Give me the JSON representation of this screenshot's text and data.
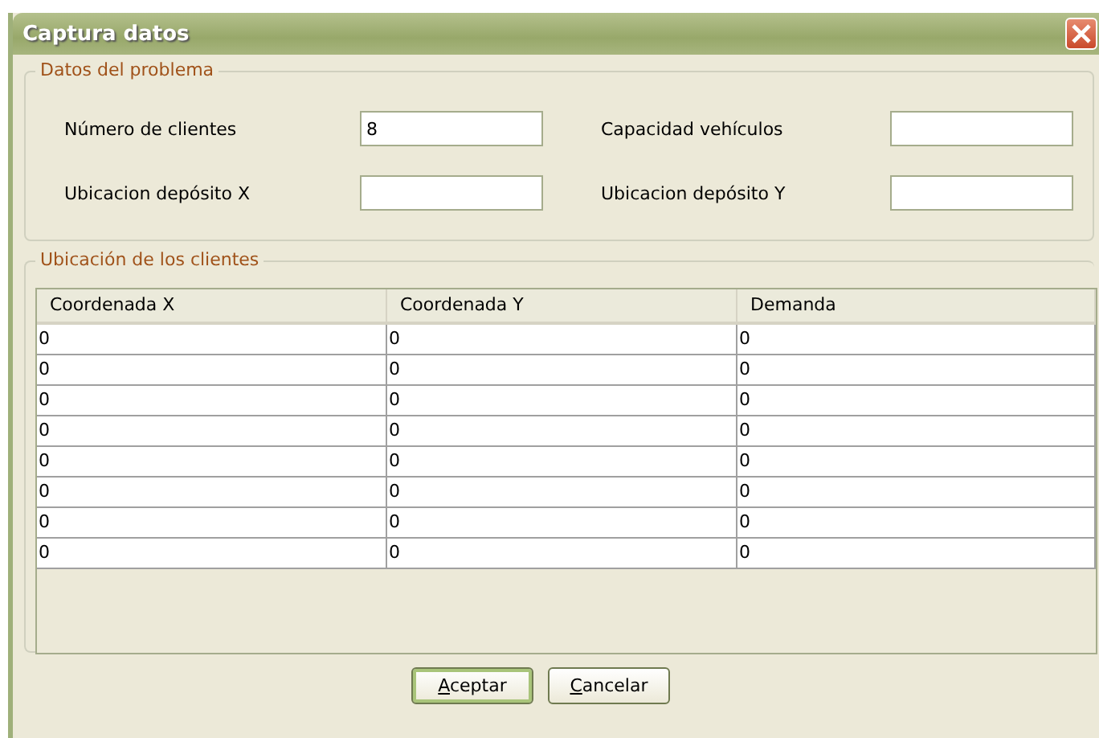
{
  "window": {
    "title": "Captura datos"
  },
  "problem_group": {
    "legend": "Datos del problema",
    "fields": [
      {
        "label": "Número de clientes",
        "value": "8"
      },
      {
        "label": "Capacidad vehículos"
      },
      {
        "label": "Ubicacion depósito X"
      },
      {
        "label": "Ubicacion depósito Y"
      }
    ]
  },
  "clients_group": {
    "legend": "Ubicación de los clientes",
    "table": {
      "columns": [
        "Coordenada X",
        "Coordenada Y",
        "Demanda"
      ],
      "rows": [
        [
          "0",
          "0",
          "0"
        ],
        [
          "0",
          "0",
          "0"
        ],
        [
          "0",
          "0",
          "0"
        ],
        [
          "0",
          "0",
          "0"
        ],
        [
          "0",
          "0",
          "0"
        ],
        [
          "0",
          "0",
          "0"
        ],
        [
          "0",
          "0",
          "0"
        ],
        [
          "0",
          "0",
          "0"
        ]
      ]
    }
  },
  "buttons": [
    {
      "label": "Aceptar",
      "default": true
    },
    {
      "label": "Cancelar",
      "default": false
    }
  ]
}
